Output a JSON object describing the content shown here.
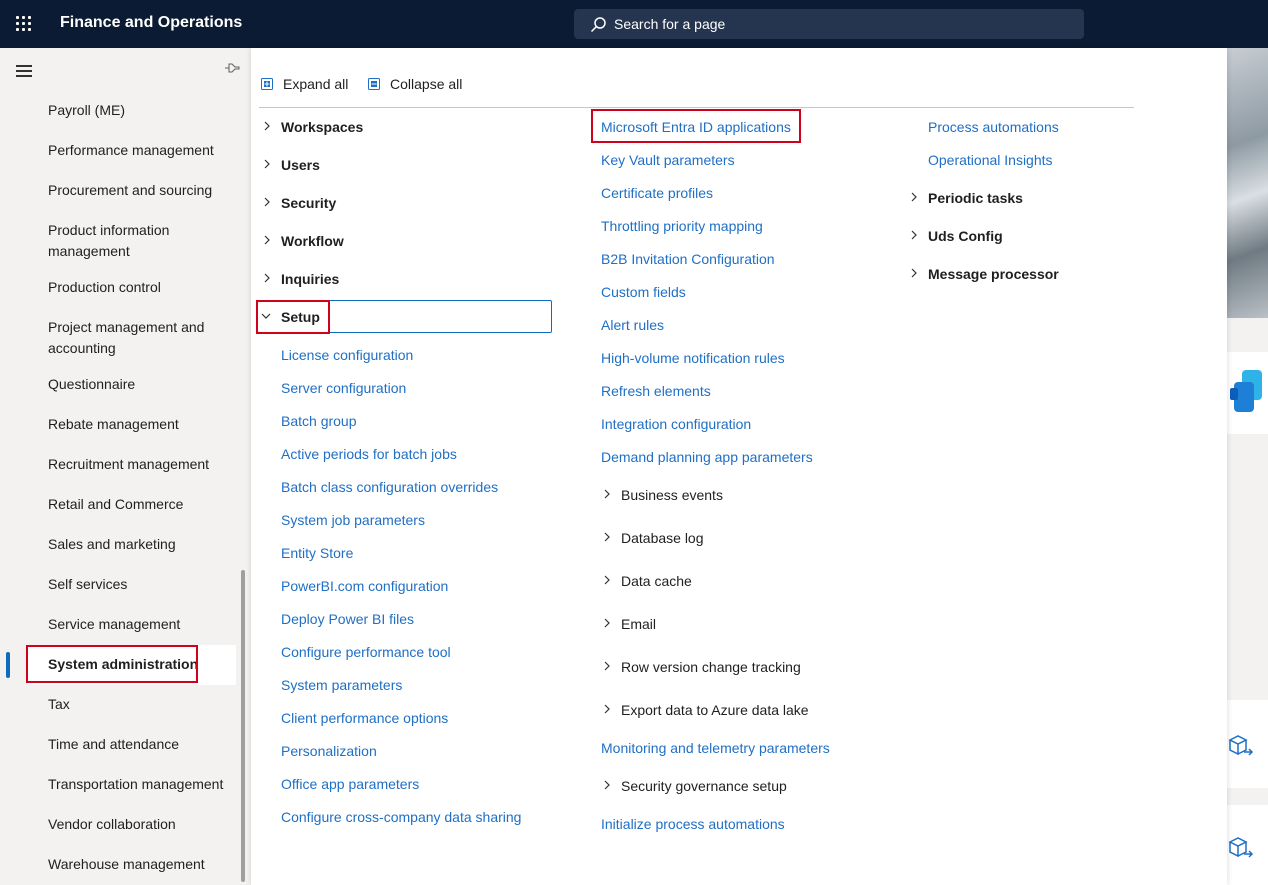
{
  "app": {
    "title": "Finance and Operations"
  },
  "search": {
    "placeholder": "Search for a page"
  },
  "toolbar": {
    "expand_all": "Expand all",
    "collapse_all": "Collapse all"
  },
  "leftnav": {
    "items": [
      "Payroll (ME)",
      "Performance management",
      "Procurement and sourcing",
      "Product information management",
      "Production control",
      "Project management and accounting",
      "Questionnaire",
      "Rebate management",
      "Recruitment management",
      "Retail and Commerce",
      "Sales and marketing",
      "Self services",
      "Service management",
      "System administration",
      "Tax",
      "Time and attendance",
      "Transportation management",
      "Vendor collaboration",
      "Warehouse management"
    ],
    "selected": "System administration"
  },
  "col1": {
    "groups": [
      "Workspaces",
      "Users",
      "Security",
      "Workflow",
      "Inquiries",
      "Setup"
    ],
    "setup_links": [
      "License configuration",
      "Server configuration",
      "Batch group",
      "Active periods for batch jobs",
      "Batch class configuration overrides",
      "System job parameters",
      "Entity Store",
      "PowerBI.com configuration",
      "Deploy Power BI files",
      "Configure performance tool",
      "System parameters",
      "Client performance options",
      "Personalization",
      "Office app parameters",
      "Configure cross-company data sharing"
    ]
  },
  "col2": {
    "links_top": [
      "Microsoft Entra ID applications",
      "Key Vault parameters",
      "Certificate profiles",
      "Throttling priority mapping",
      "B2B Invitation Configuration",
      "Custom fields",
      "Alert rules",
      "High-volume notification rules",
      "Refresh elements",
      "Integration configuration",
      "Demand planning app parameters"
    ],
    "subgroups_a": [
      "Business events",
      "Database log",
      "Data cache",
      "Email",
      "Row version change tracking",
      "Export data to Azure data lake"
    ],
    "link_mid": "Monitoring and telemetry parameters",
    "subgroup_b": "Security governance setup",
    "link_bottom": "Initialize process automations"
  },
  "col3": {
    "links": [
      "Process automations",
      "Operational Insights"
    ],
    "groups": [
      "Periodic tasks",
      "Uds Config",
      "Message processor"
    ]
  },
  "colors": {
    "topbar": "#0b1b33",
    "link": "#1f6fc5",
    "highlight": "#d0021b",
    "accent": "#0f6cbd"
  }
}
